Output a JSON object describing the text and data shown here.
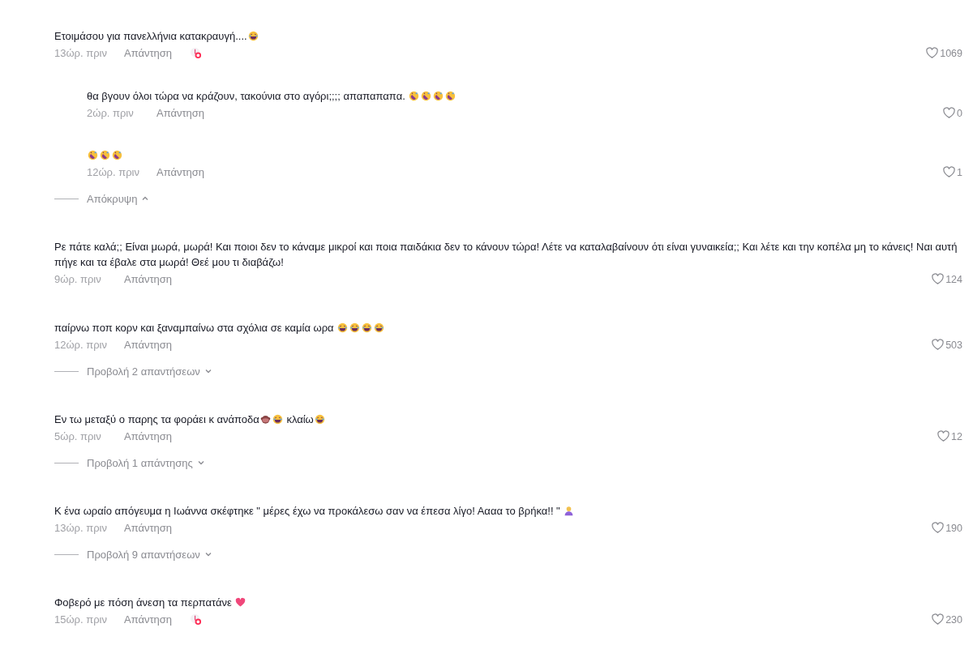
{
  "comments": [
    {
      "parts": [
        {
          "kind": "text",
          "text": "Ετοιμάσου για πανελλήνια κατακραυγή...."
        },
        {
          "kind": "laugh"
        }
      ],
      "time": "13ώρ. πριν",
      "reply": "Απάντηση",
      "creator_liked": true,
      "likes": "1069",
      "replies": [
        {
          "parts": [
            {
              "kind": "text",
              "text": "θα βγουν όλοι τώρα να κράζουν, τακούνια στο αγόρι;;;; απαπαπαπα. "
            },
            {
              "kind": "rofl"
            },
            {
              "kind": "rofl"
            },
            {
              "kind": "rofl"
            },
            {
              "kind": "rofl"
            }
          ],
          "time": "2ώρ. πριν",
          "reply": "Απάντηση",
          "likes": "0"
        },
        {
          "parts": [
            {
              "kind": "rofl"
            },
            {
              "kind": "rofl"
            },
            {
              "kind": "rofl"
            }
          ],
          "time": "12ώρ. πριν",
          "reply": "Απάντηση",
          "likes": "1"
        }
      ],
      "toggle": {
        "label": "Απόκρυψη",
        "expanded": true
      }
    },
    {
      "parts": [
        {
          "kind": "text",
          "text": "Ρε πάτε καλά;; Είναι μωρά, μωρά! Και ποιοι δεν το κάναμε μικροί και ποια παιδάκια δεν το κάνουν τώρα! Λέτε να καταλαβαίνουν ότι είναι γυναικεία;; Και λέτε και την κοπέλα μη το κάνεις! Ναι αυτή πήγε και τα έβαλε στα μωρά! Θεέ μου τι διαβάζω!"
        }
      ],
      "time": "9ώρ. πριν",
      "reply": "Απάντηση",
      "creator_liked": false,
      "likes": "124"
    },
    {
      "parts": [
        {
          "kind": "text",
          "text": "παίρνω ποπ κορν και ξαναμπαίνω στα σχόλια σε καμία ωρα "
        },
        {
          "kind": "laugh"
        },
        {
          "kind": "laugh"
        },
        {
          "kind": "laugh"
        },
        {
          "kind": "laugh"
        }
      ],
      "time": "12ώρ. πριν",
      "reply": "Απάντηση",
      "creator_liked": false,
      "likes": "503",
      "toggle": {
        "label": "Προβολή 2 απαντήσεων",
        "expanded": false
      }
    },
    {
      "parts": [
        {
          "kind": "text",
          "text": "Εν τω μεταξύ ο παρης τα φοράει κ ανάποδα"
        },
        {
          "kind": "monkey"
        },
        {
          "kind": "laugh"
        },
        {
          "kind": "text",
          "text": " κλαίω"
        },
        {
          "kind": "laugh"
        }
      ],
      "time": "5ώρ. πριν",
      "reply": "Απάντηση",
      "creator_liked": false,
      "likes": "12",
      "toggle": {
        "label": "Προβολή 1 απάντησης",
        "expanded": false
      }
    },
    {
      "parts": [
        {
          "kind": "text",
          "text": "Κ ένα ωραίο απόγευμα η Ιωάννα σκέφτηκε \" μέρες έχω να προκάλεσω σαν να έπεσα λίγο! Αααα το βρήκα!! \" "
        },
        {
          "kind": "person"
        }
      ],
      "time": "13ώρ. πριν",
      "reply": "Απάντηση",
      "creator_liked": false,
      "likes": "190",
      "toggle": {
        "label": "Προβολή 9 απαντήσεων",
        "expanded": false
      }
    },
    {
      "parts": [
        {
          "kind": "text",
          "text": "Φοβερό με πόση άνεση τα περπατάνε "
        },
        {
          "kind": "heart"
        }
      ],
      "time": "15ώρ. πριν",
      "reply": "Απάντηση",
      "creator_liked": true,
      "likes": "230"
    }
  ]
}
